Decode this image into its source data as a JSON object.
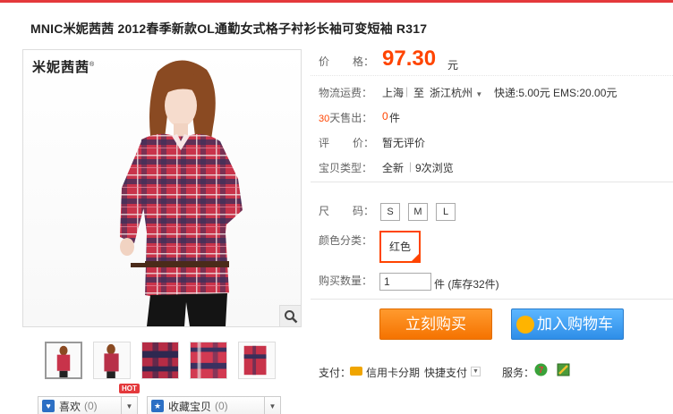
{
  "product": {
    "title": "MNIC米妮茜茜 2012春季新款OL通勤女式格子衬衫长袖可变短袖 R317"
  },
  "gallery": {
    "brand_logo": "米妮茜茜",
    "thumbnails": [
      "thumb-1",
      "thumb-2",
      "thumb-3",
      "thumb-4",
      "thumb-5"
    ]
  },
  "actions": {
    "like_label": "喜欢",
    "like_count": "(0)",
    "hot_badge": "HOT",
    "collect_label": "收藏宝贝",
    "collect_count": "(0)"
  },
  "info": {
    "price_label_1": "价",
    "price_label_2": "格：",
    "price": "97.30",
    "price_unit": "元",
    "shipping_label": "物流运费：",
    "shipping_from": "上海",
    "shipping_to_sep": "至",
    "shipping_to": "浙江杭州",
    "shipping_cost": "快递:5.00元 EMS:20.00元",
    "sold_days": "30",
    "sold_label": "天售出：",
    "sold_count": "0",
    "sold_unit": "件",
    "rating_label_1": "评",
    "rating_label_2": "价：",
    "rating_value": "暂无评价",
    "type_label": "宝贝类型：",
    "type_value": "全新",
    "views": "9次浏览"
  },
  "options": {
    "size_label_1": "尺",
    "size_label_2": "码：",
    "sizes": [
      "S",
      "M",
      "L"
    ],
    "color_label": "颜色分类：",
    "color_selected": "红色",
    "qty_label": "购买数量：",
    "qty_value": "1",
    "stock_text": "件 (库存32件)"
  },
  "buttons": {
    "buy_now": "立刻购买",
    "add_to_cart": "加入购物车"
  },
  "payment": {
    "label": "支付：",
    "credit": "信用卡分期",
    "quick": "快捷支付",
    "service_label": "服务："
  },
  "colors": {
    "accent": "#ff4400",
    "buy": "#f57300",
    "cart": "#2e8ee8"
  }
}
